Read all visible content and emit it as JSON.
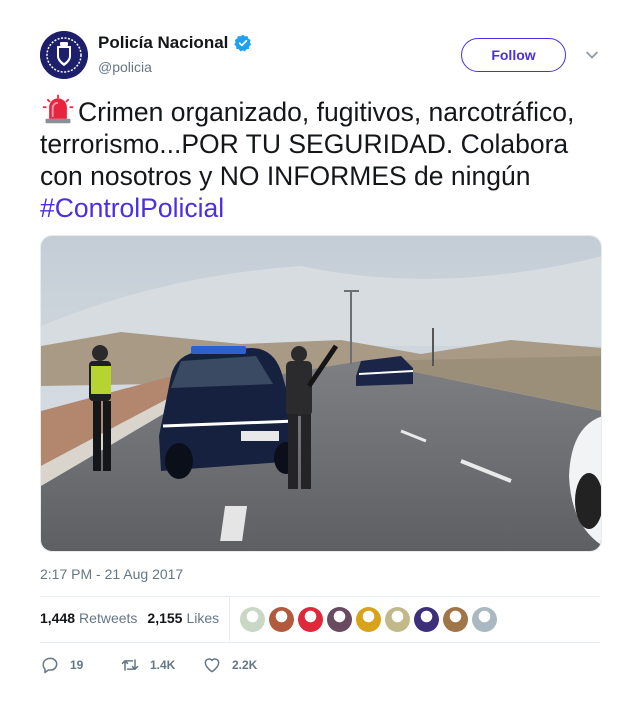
{
  "user": {
    "display_name": "Policía Nacional",
    "handle": "@policia",
    "verified": true
  },
  "follow_button": {
    "label": "Follow"
  },
  "tweet": {
    "text": "Crimen organizado, fugitivos, narcotráfico, terrorismo...POR TU SEGURIDAD. Colabora con nosotros y NO INFORMES de ningún ",
    "hashtag": "#ControlPolicial",
    "leading_emoji": "police-car-light",
    "timestamp": "2:17 PM - 21 Aug 2017"
  },
  "stats": {
    "retweets_count": "1,448",
    "retweets_label": "Retweets",
    "likes_count": "2,155",
    "likes_label": "Likes"
  },
  "likers": [
    {
      "color": "#c9d8c5"
    },
    {
      "color": "#b35a3e"
    },
    {
      "color": "#e0283a"
    },
    {
      "color": "#6a4a5e"
    },
    {
      "color": "#d8a21a"
    },
    {
      "color": "#c2b98a"
    },
    {
      "color": "#3e2f7a"
    },
    {
      "color": "#a07548"
    },
    {
      "color": "#aab8c2"
    }
  ],
  "actions": {
    "replies": "19",
    "retweets": "1.4K",
    "likes": "2.2K"
  },
  "colors": {
    "accent": "#4b2fe0",
    "verified": "#1da1f2",
    "muted": "#657786"
  },
  "icons": [
    "verified-badge-icon",
    "chevron-down-icon",
    "police-light-icon",
    "reply-icon",
    "retweet-icon",
    "heart-icon"
  ]
}
